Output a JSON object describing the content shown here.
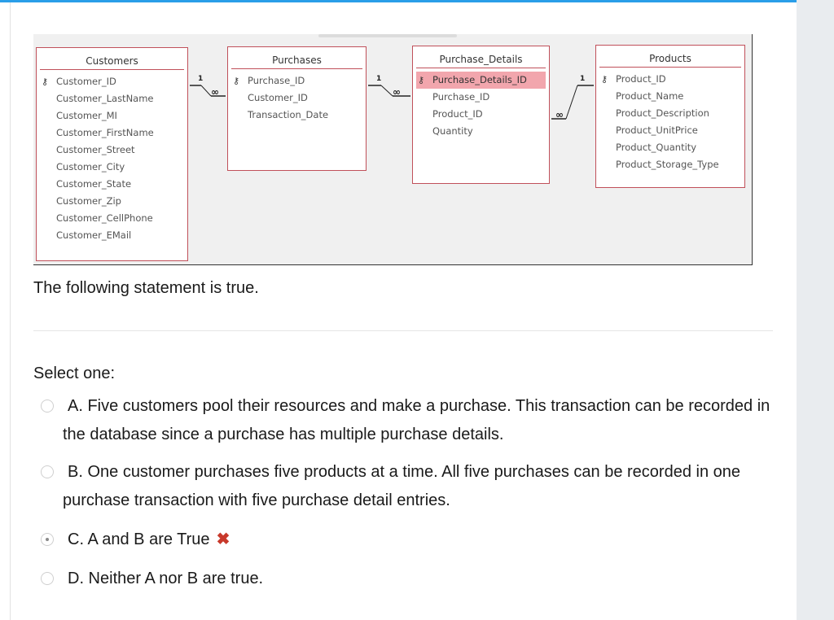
{
  "diagram": {
    "tables": [
      {
        "title": "Customers",
        "fields": [
          "Customer_ID",
          "Customer_LastName",
          "Customer_MI",
          "Customer_FirstName",
          "Customer_Street",
          "Customer_City",
          "Customer_State",
          "Customer_Zip",
          "Customer_CellPhone",
          "Customer_EMail"
        ]
      },
      {
        "title": "Purchases",
        "fields": [
          "Purchase_ID",
          "Customer_ID",
          "Transaction_Date"
        ]
      },
      {
        "title": "Purchase_Details",
        "fields": [
          "Purchase_Details_ID",
          "Purchase_ID",
          "Product_ID",
          "Quantity"
        ]
      },
      {
        "title": "Products",
        "fields": [
          "Product_ID",
          "Product_Name",
          "Product_Description",
          "Product_UnitPrice",
          "Product_Quantity",
          "Product_Storage_Type"
        ]
      }
    ],
    "relationship_labels": {
      "one": "1",
      "many": "∞"
    }
  },
  "statement": "The following statement is true.",
  "select_label": "Select one:",
  "options": [
    {
      "text": "A. Five customers pool their resources and make a purchase. This transaction can be recorded in the database since a purchase has multiple purchase details.",
      "selected": false
    },
    {
      "text": "B. One customer purchases five products at a time.  All five purchases can be recorded in one purchase transaction with five purchase detail entries.",
      "selected": false
    },
    {
      "text": "C. A and B are True",
      "selected": true,
      "marked_wrong": true
    },
    {
      "text": "D. Neither A nor B are true.",
      "selected": false
    }
  ],
  "icons": {
    "wrong": "✖",
    "key": "key-icon"
  },
  "colors": {
    "accent": "#2a9ee8",
    "table_border": "#c0505a",
    "selected_field": "#f2a6ad",
    "wrong": "#c8392b"
  }
}
